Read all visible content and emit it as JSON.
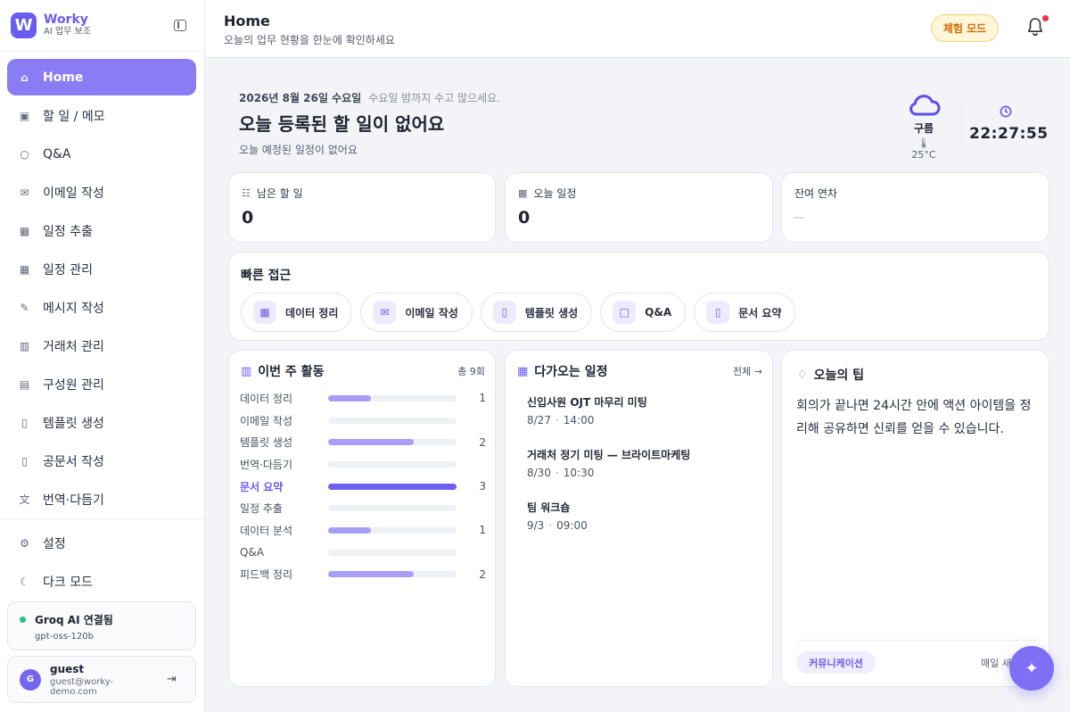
{
  "sidebar": {
    "brand_letter": "W",
    "brand_name": "Worky",
    "brand_sub": "AI 업무 보조",
    "items": [
      {
        "label": "Home",
        "icon": "home-icon"
      },
      {
        "label": "할 일 / 메모",
        "icon": "clipboard-icon"
      },
      {
        "label": "Q&A",
        "icon": "chat-icon"
      },
      {
        "label": "이메일 작성",
        "icon": "mail-icon"
      },
      {
        "label": "일정 추출",
        "icon": "calendar-icon"
      },
      {
        "label": "일정 관리",
        "icon": "calendar-icon"
      },
      {
        "label": "메시지 작성",
        "icon": "edit-icon"
      },
      {
        "label": "거래처 관리",
        "icon": "building-icon"
      },
      {
        "label": "구성원 관리",
        "icon": "id-card-icon"
      },
      {
        "label": "템플릿 생성",
        "icon": "document-icon"
      },
      {
        "label": "공문서 작성",
        "icon": "document-icon"
      },
      {
        "label": "번역·다듬기",
        "icon": "translate-icon"
      }
    ],
    "settings": "설정",
    "dark_mode": "다크 모드",
    "ai": {
      "title": "Groq AI 연결됨",
      "model": "gpt-oss-120b",
      "status_color": "#1fc47d"
    },
    "user": {
      "initial": "G",
      "name": "guest",
      "email": "guest@worky-demo.com"
    }
  },
  "header": {
    "title": "Home",
    "subtitle": "오늘의 업무 현황을 한눈에 확인하세요",
    "trial_badge": "체험 모드"
  },
  "hero": {
    "date": "2026년 8월 26일 수요일",
    "greeting": "수요일 밤까지 수고 많으세요.",
    "title": "오늘 등록된 할 일이 없어요",
    "subtitle": "오늘 예정된 일정이 없어요",
    "weather": {
      "condition": "구름",
      "temperature": "25°C",
      "icon": "cloud-icon"
    },
    "clock": {
      "time": "22:27:55",
      "icon": "clock-icon"
    }
  },
  "stats": [
    {
      "label": "남은 할 일",
      "value": "0",
      "icon": "checklist-icon"
    },
    {
      "label": "오늘 일정",
      "value": "0",
      "icon": "calendar-icon"
    },
    {
      "label": "잔여 연차",
      "value": ""
    }
  ],
  "quick_access": {
    "title": "빠른 접근",
    "items": [
      {
        "label": "데이터 정리",
        "icon": "table-icon"
      },
      {
        "label": "이메일 작성",
        "icon": "mail-icon"
      },
      {
        "label": "템플릿 생성",
        "icon": "document-icon"
      },
      {
        "label": "Q&A",
        "icon": "chat-icon"
      },
      {
        "label": "문서 요약",
        "icon": "document-icon"
      }
    ]
  },
  "activity": {
    "title": "이번 주 활동",
    "total": "총 9회",
    "max": 3,
    "items": [
      {
        "label": "데이터 정리",
        "count": 1,
        "count_text": "1"
      },
      {
        "label": "이메일 작성",
        "count": 0,
        "count_text": ""
      },
      {
        "label": "템플릿 생성",
        "count": 2,
        "count_text": "2"
      },
      {
        "label": "번역·다듬기",
        "count": 0,
        "count_text": ""
      },
      {
        "label": "문서 요약",
        "count": 3,
        "count_text": "3"
      },
      {
        "label": "일정 추출",
        "count": 0,
        "count_text": ""
      },
      {
        "label": "데이터 분석",
        "count": 1,
        "count_text": "1"
      },
      {
        "label": "Q&A",
        "count": 0,
        "count_text": ""
      },
      {
        "label": "피드백 정리",
        "count": 2,
        "count_text": "2"
      }
    ]
  },
  "upcoming": {
    "title": "다가오는 일정",
    "link": "전체 →",
    "events": [
      {
        "title": "신입사원 OJT 마무리 미팅",
        "date": "8/27",
        "time": "14:00"
      },
      {
        "title": "거래처 정기 미팅 — 브라이트마케팅",
        "date": "8/30",
        "time": "10:30"
      },
      {
        "title": "팀 워크숍",
        "date": "9/3",
        "time": "09:00"
      }
    ]
  },
  "tip": {
    "title": "오늘의 팁",
    "text": "회의가 끝나면 24시간 안에 액션 아이템을 정리해 공유하면 신뢰를 얻을 수 있습니다.",
    "tag": "커뮤니케이션",
    "note": "매일 새로"
  },
  "colors": {
    "accent": "#6b5cf0",
    "trial": "#d56b00"
  }
}
